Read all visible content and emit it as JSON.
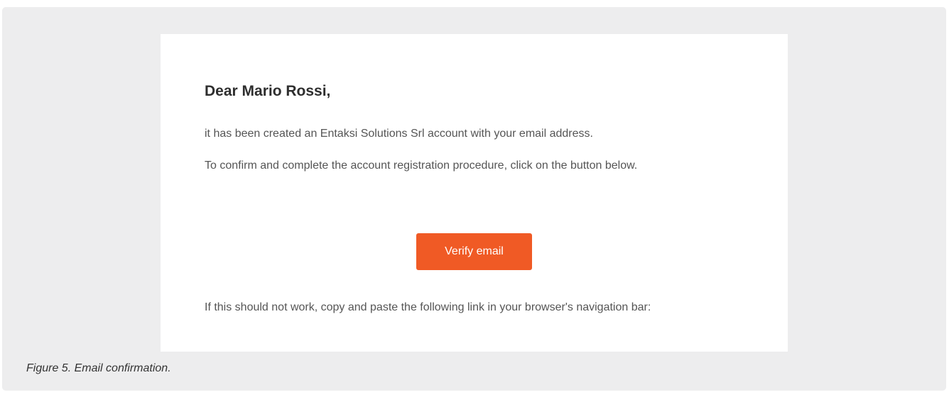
{
  "email": {
    "greeting": "Dear Mario Rossi,",
    "paragraph_1": "it has been created an Entaksi Solutions Srl account with your email address.",
    "paragraph_2": "To confirm and complete the account registration procedure, click on the button below.",
    "button_label": "Verify email",
    "paragraph_3": "If this should not work, copy and paste the following link in your browser's navigation bar:"
  },
  "caption": "Figure 5. Email confirmation.",
  "colors": {
    "button_background": "#f05a25",
    "card_background": "#ffffff",
    "outer_background": "#ededee"
  }
}
